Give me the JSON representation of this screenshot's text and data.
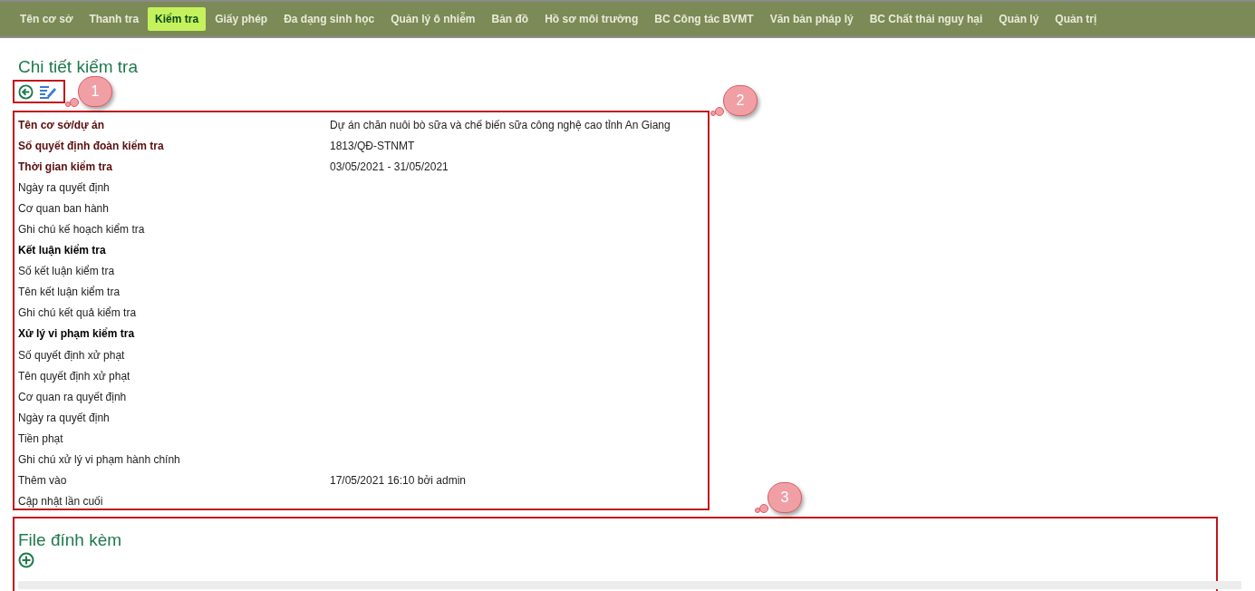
{
  "nav": [
    {
      "label": "Tên cơ sở",
      "selected": false
    },
    {
      "label": "Thanh tra",
      "selected": false
    },
    {
      "label": "Kiểm tra",
      "selected": true
    },
    {
      "label": "Giấy phép",
      "selected": false
    },
    {
      "label": "Đa dạng sinh học",
      "selected": false
    },
    {
      "label": "Quản lý ô nhiễm",
      "selected": false
    },
    {
      "label": "Bản đồ",
      "selected": false
    },
    {
      "label": "Hồ sơ môi trường",
      "selected": false
    },
    {
      "label": "BC Công tác BVMT",
      "selected": false
    },
    {
      "label": "Văn bản pháp lý",
      "selected": false
    },
    {
      "label": "BC Chất thải nguy hại",
      "selected": false
    },
    {
      "label": "Quản lý",
      "selected": false
    },
    {
      "label": "Quản trị",
      "selected": false
    }
  ],
  "title": "Chi tiết kiểm tra",
  "callouts": [
    "1",
    "2",
    "3"
  ],
  "details": [
    {
      "kind": "required",
      "label": "Tên cơ sở/dự án",
      "value": "Dự án chăn nuôi bò sữa và chế biến sữa công nghệ cao tỉnh An Giang"
    },
    {
      "kind": "required",
      "label": "Số quyết định đoàn kiểm tra",
      "value": "1813/QĐ-STNMT"
    },
    {
      "kind": "required",
      "label": "Thời gian kiểm tra",
      "value": "03/05/2021 - 31/05/2021"
    },
    {
      "kind": "field",
      "label": "Ngày ra quyết định"
    },
    {
      "kind": "field",
      "label": "Cơ quan ban hành"
    },
    {
      "kind": "field",
      "label": "Ghi chú kế hoạch kiểm tra"
    },
    {
      "kind": "section",
      "label": "Kết luận kiểm tra"
    },
    {
      "kind": "field",
      "label": "Số kết luận kiểm tra"
    },
    {
      "kind": "field",
      "label": "Tên kết luận kiểm tra"
    },
    {
      "kind": "field",
      "label": "Ghi chú kết quả kiểm tra"
    },
    {
      "kind": "section",
      "label": "Xử lý vi phạm kiểm tra"
    },
    {
      "kind": "field",
      "label": "Số quyết định xử phạt"
    },
    {
      "kind": "field",
      "label": "Tên quyết định xử phạt"
    },
    {
      "kind": "field",
      "label": "Cơ quan ra quyết định"
    },
    {
      "kind": "field",
      "label": "Ngày ra quyết định"
    },
    {
      "kind": "field",
      "label": "Tiền phạt"
    },
    {
      "kind": "field",
      "label": "Ghi chú xử lý vi phạm hành chính"
    },
    {
      "kind": "field",
      "label": "Thêm vào",
      "value": "17/05/2021 16:10 bởi admin"
    },
    {
      "kind": "field",
      "label": "Cập nhật lần cuối"
    }
  ],
  "attachments": {
    "title": "File đính kèm"
  }
}
